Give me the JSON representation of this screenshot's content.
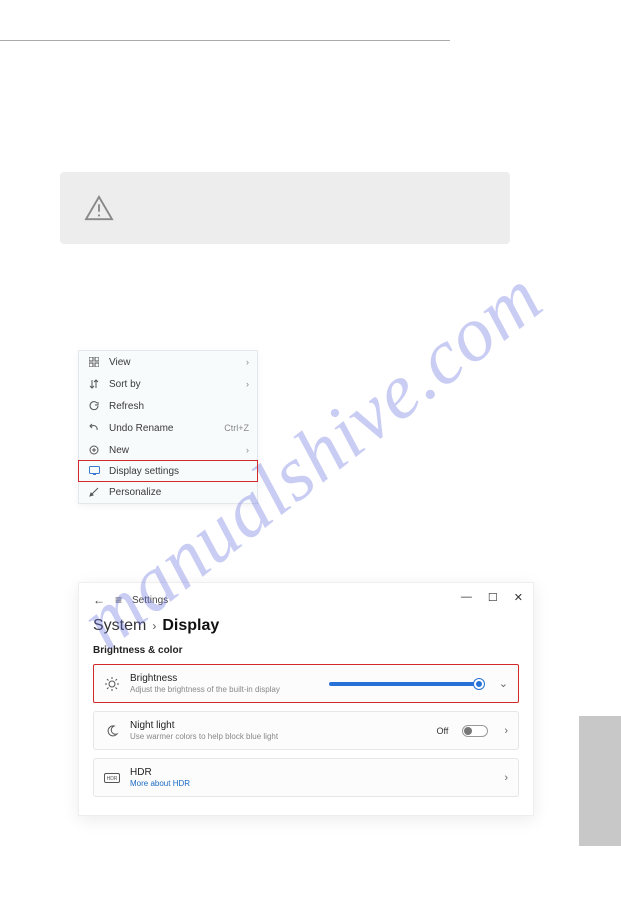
{
  "watermark": "manualshive.com",
  "context_menu": {
    "items": [
      {
        "label": "View",
        "has_submenu": true
      },
      {
        "label": "Sort by",
        "has_submenu": true
      },
      {
        "label": "Refresh"
      },
      {
        "label": "Undo Rename",
        "shortcut": "Ctrl+Z"
      },
      {
        "label": "New",
        "has_submenu": true
      },
      {
        "label": "Display settings",
        "highlight": true
      },
      {
        "label": "Personalize"
      }
    ]
  },
  "settings": {
    "app_name": "Settings",
    "breadcrumb_parent": "System",
    "breadcrumb_current": "Display",
    "section": "Brightness & color",
    "panels": {
      "brightness": {
        "title": "Brightness",
        "desc": "Adjust the brightness of the built-in display"
      },
      "nightlight": {
        "title": "Night light",
        "desc": "Use warmer colors to help block blue light",
        "state": "Off"
      },
      "hdr": {
        "title": "HDR",
        "link": "More about HDR"
      }
    }
  }
}
